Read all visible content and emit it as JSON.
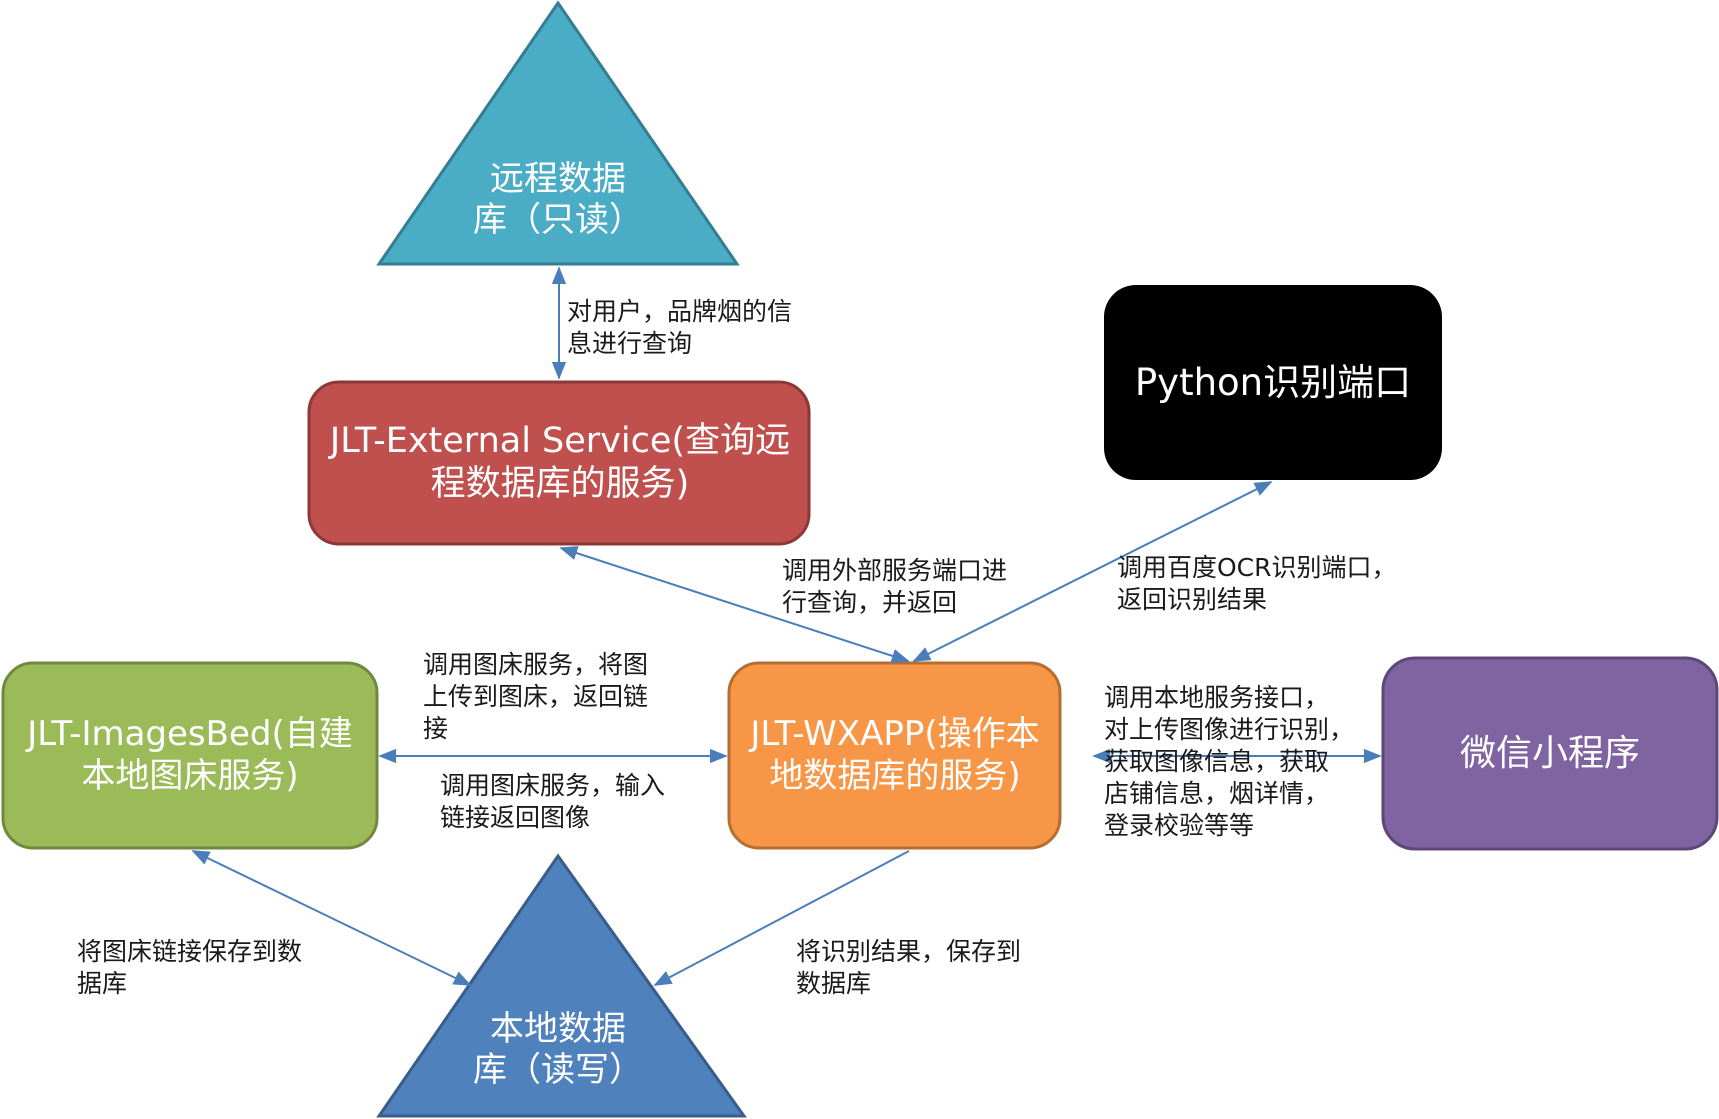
{
  "nodes": {
    "remote_db": {
      "label": "远程数据\n库（只读）",
      "color": "#4bacc6"
    },
    "external_service": {
      "label": "JLT-External Service(查询远程数据库的服务)",
      "color": "#c0504d"
    },
    "python_ocr": {
      "label": "Python识别端口",
      "color": "#000000"
    },
    "images_bed": {
      "label": "JLT-ImagesBed(自建本地图床服务)",
      "color": "#9bbb59"
    },
    "wxapp": {
      "label": "JLT-WXAPP(操作本地数据库的服务)",
      "color": "#f79646"
    },
    "wechat_miniprogram": {
      "label": "微信小程序",
      "color": "#8064a2"
    },
    "local_db": {
      "label": "本地数据\n库（读写）",
      "color": "#4f81bd"
    }
  },
  "edges": {
    "remote_external": {
      "label": "对用户，品牌烟的信\n息进行查询"
    },
    "external_wxapp": {
      "label": "调用外部服务端口进\n行查询，并返回"
    },
    "python_wxapp": {
      "label": "调用百度OCR识别端口，\n返回识别结果"
    },
    "imagesbed_wxapp_upload": {
      "label": "调用图床服务，将图\n上传到图床，返回链\n接"
    },
    "imagesbed_wxapp_input": {
      "label": "调用图床服务，输入\n链接返回图像"
    },
    "wechat_wxapp": {
      "label": "调用本地服务接口，\n对上传图像进行识别，\n获取图像信息，获取\n店铺信息，烟详情，\n登录校验等等"
    },
    "imagesbed_localdb": {
      "label": "将图床链接保存到数\n据库"
    },
    "wxapp_localdb": {
      "label": "将识别结果，保存到\n数据库"
    }
  },
  "colors": {
    "arrow": "#4a7ebb",
    "label_text": "#1a1a1a"
  }
}
